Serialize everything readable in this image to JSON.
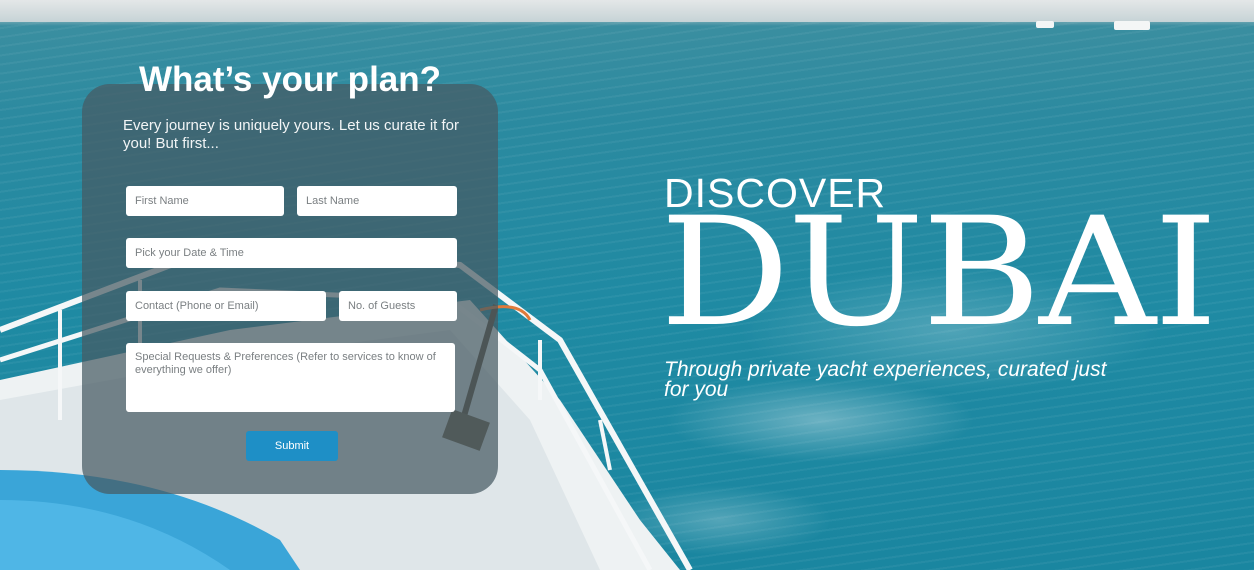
{
  "form": {
    "title": "What’s your plan?",
    "intro": "Every journey is uniquely yours. Let us curate it for you! But first...",
    "fields": {
      "first_name_placeholder": "First Name",
      "last_name_placeholder": "Last Name",
      "date_time_placeholder": "Pick your Date & Time",
      "contact_placeholder": "Contact (Phone or Email)",
      "guests_placeholder": "No. of Guests",
      "requests_placeholder": "Special Requests & Preferences (Refer to services to know of everything we offer)"
    },
    "submit_label": "Submit"
  },
  "hero": {
    "discover": "DISCOVER",
    "city": "DUBAI",
    "tagline": "Through private yacht experiences, curated just for you"
  },
  "colors": {
    "sea": "#1f8aa3",
    "panel": "#465a62",
    "submit": "#1e8fc6",
    "text": "#ffffff"
  }
}
